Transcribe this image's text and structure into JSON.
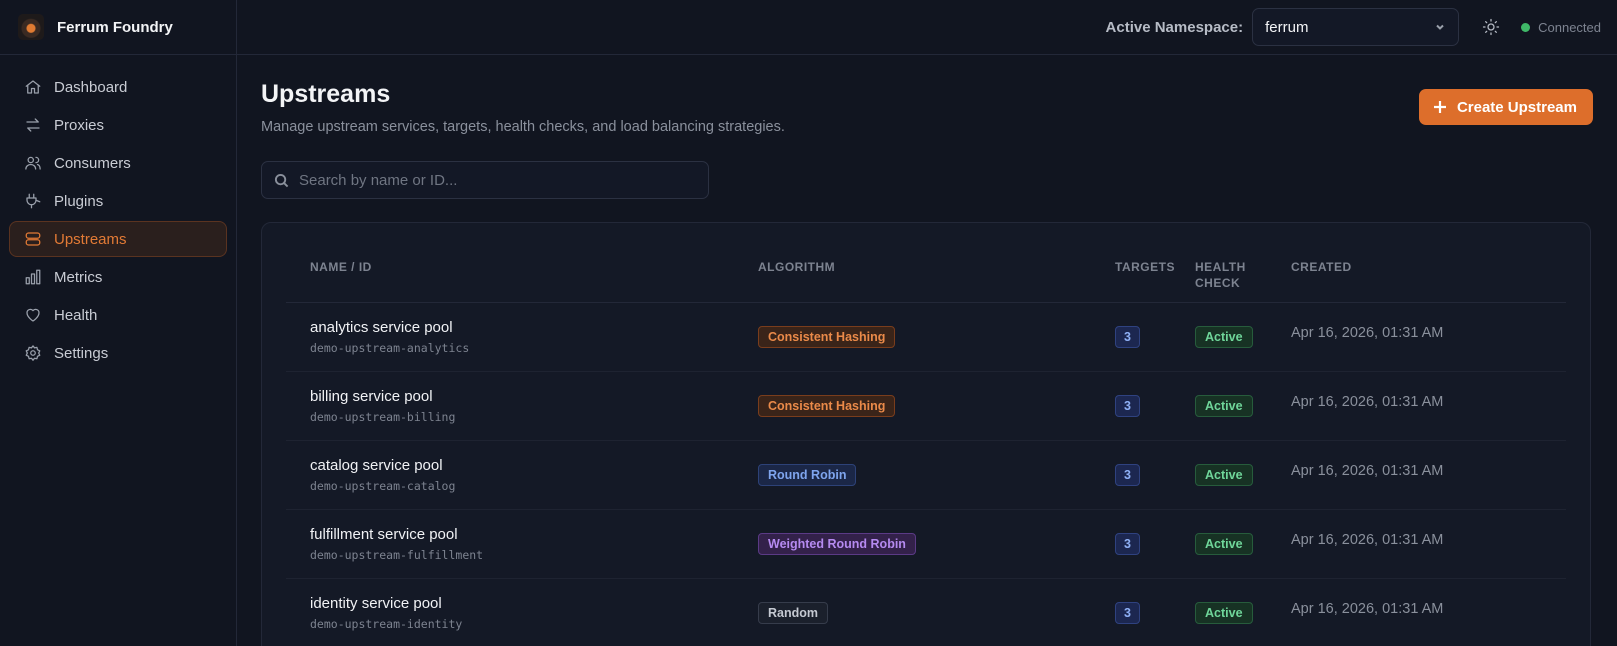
{
  "app": {
    "name": "Ferrum Foundry"
  },
  "sidebar": {
    "items": [
      {
        "label": "Dashboard",
        "icon": "home-icon"
      },
      {
        "label": "Proxies",
        "icon": "arrows-swap-icon"
      },
      {
        "label": "Consumers",
        "icon": "users-icon"
      },
      {
        "label": "Plugins",
        "icon": "plug-icon"
      },
      {
        "label": "Upstreams",
        "icon": "server-stack-icon",
        "active": true
      },
      {
        "label": "Metrics",
        "icon": "bar-chart-icon"
      },
      {
        "label": "Health",
        "icon": "heart-icon"
      },
      {
        "label": "Settings",
        "icon": "gear-icon"
      }
    ]
  },
  "topbar": {
    "namespace_label": "Active Namespace:",
    "namespace_value": "ferrum",
    "status": "Connected"
  },
  "page": {
    "title": "Upstreams",
    "subtitle": "Manage upstream services, targets, health checks, and load balancing strategies.",
    "create_label": "Create Upstream",
    "search_placeholder": "Search by name or ID..."
  },
  "table": {
    "headers": {
      "name": "NAME / ID",
      "algorithm": "ALGORITHM",
      "targets": "TARGETS",
      "health": "HEALTH CHECK",
      "created": "CREATED"
    },
    "rows": [
      {
        "name": "analytics service pool",
        "id": "demo-upstream-analytics",
        "algorithm": "Consistent Hashing",
        "algo_style": "hash",
        "targets": "3",
        "health": "Active",
        "created": "Apr 16, 2026, 01:31 AM"
      },
      {
        "name": "billing service pool",
        "id": "demo-upstream-billing",
        "algorithm": "Consistent Hashing",
        "algo_style": "hash",
        "targets": "3",
        "health": "Active",
        "created": "Apr 16, 2026, 01:31 AM"
      },
      {
        "name": "catalog service pool",
        "id": "demo-upstream-catalog",
        "algorithm": "Round Robin",
        "algo_style": "rr",
        "targets": "3",
        "health": "Active",
        "created": "Apr 16, 2026, 01:31 AM"
      },
      {
        "name": "fulfillment service pool",
        "id": "demo-upstream-fulfillment",
        "algorithm": "Weighted Round Robin",
        "algo_style": "wrr",
        "targets": "3",
        "health": "Active",
        "created": "Apr 16, 2026, 01:31 AM"
      },
      {
        "name": "identity service pool",
        "id": "demo-upstream-identity",
        "algorithm": "Random",
        "algo_style": "rand",
        "targets": "3",
        "health": "Active",
        "created": "Apr 16, 2026, 01:31 AM"
      }
    ]
  },
  "colors": {
    "accent": "#dd6e2b",
    "status_connected": "#3fb868",
    "background": "#111520"
  }
}
